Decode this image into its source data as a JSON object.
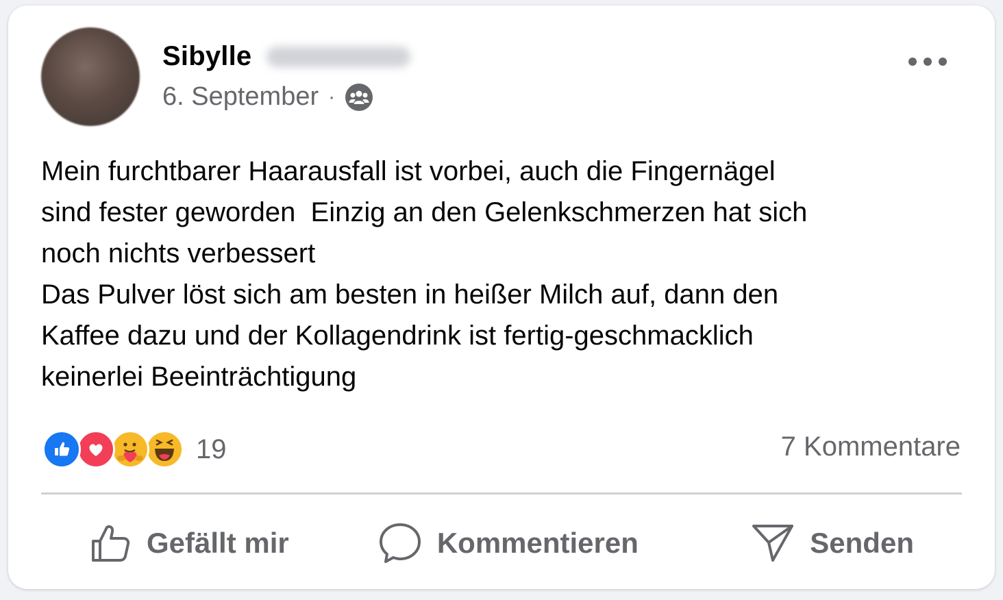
{
  "post": {
    "author_first_name": "Sibylle",
    "date": "6. September",
    "separator": "·",
    "audience_icon": "group-icon",
    "text": "Mein furchtbarer Haarausfall ist vorbei, auch die Fingernägel\nsind fester geworden  Einzig an den Gelenkschmerzen hat sich\nnoch nichts verbessert\nDas Pulver löst sich am besten in heißer Milch auf, dann den\nKaffee dazu und der Kollagendrink ist fertig-geschmacklich\nkeinerlei Beeinträchtigung"
  },
  "reactions": {
    "types": [
      "like",
      "love",
      "care",
      "haha"
    ],
    "count": "19"
  },
  "comments_label": "7 Kommentare",
  "actions": {
    "like_label": "Gefällt mir",
    "comment_label": "Kommentieren",
    "send_label": "Senden"
  },
  "colors": {
    "like": "#1877f2",
    "love": "#f33e58",
    "care": "#f7b928",
    "haha": "#f7b928",
    "secondary_text": "#65676b"
  }
}
